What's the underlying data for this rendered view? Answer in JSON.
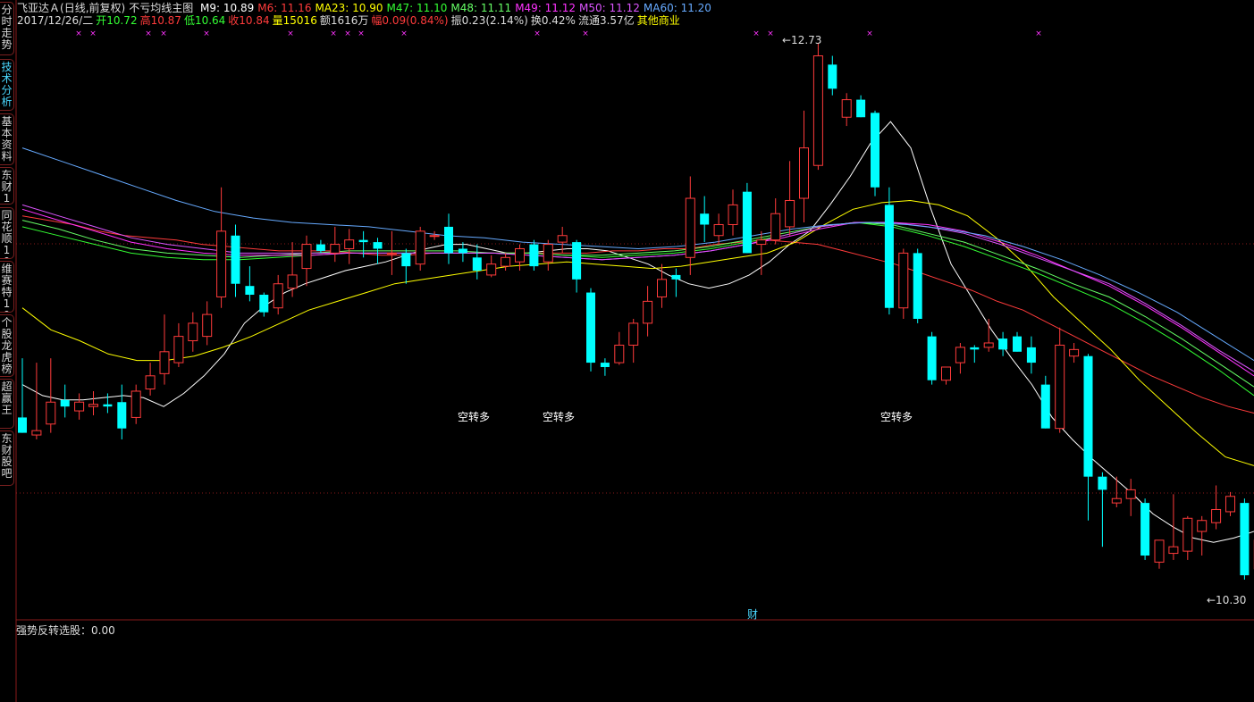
{
  "sidebar": [
    {
      "label": "分时走势",
      "active": false
    },
    {
      "label": "技术分析",
      "active": true
    },
    {
      "label": "基本资料",
      "active": false
    },
    {
      "label": "东财10",
      "active": false
    },
    {
      "label": "同花顺10",
      "active": false
    },
    {
      "label": "维赛特10",
      "active": false
    },
    {
      "label": "个股龙虎榜",
      "active": false
    },
    {
      "label": "超赢王",
      "active": false
    },
    {
      "label": "东财股吧",
      "active": false
    }
  ],
  "header": {
    "name": "飞亚达Ａ",
    "mode": "(日线,前复权)",
    "template": "不亏均线主图",
    "ma": [
      {
        "label": "M9: 10.89",
        "color": "#ffffff"
      },
      {
        "label": "M6: 11.16",
        "color": "#ff3b3b"
      },
      {
        "label": "MA23: 10.90",
        "color": "#ffff00"
      },
      {
        "label": "M47: 11.10",
        "color": "#33ff33"
      },
      {
        "label": "M48: 11.11",
        "color": "#66ff66"
      },
      {
        "label": "M49: 11.12",
        "color": "#ff33ff"
      },
      {
        "label": "M50: 11.12",
        "color": "#dd55ff"
      },
      {
        "label": "MA60: 11.20",
        "color": "#66aaff"
      }
    ],
    "info": [
      {
        "text": "2017/12/26/二",
        "color": "#dddddd"
      },
      {
        "text": "开10.72",
        "color": "#33ff33"
      },
      {
        "text": "高10.87",
        "color": "#ff3b3b"
      },
      {
        "text": "低10.64",
        "color": "#33ff33"
      },
      {
        "text": "收10.84",
        "color": "#ff3b3b"
      },
      {
        "text": "量15016",
        "color": "#ffff00"
      },
      {
        "text": "额1616万",
        "color": "#dddddd"
      },
      {
        "text": "幅0.09(0.84%)",
        "color": "#ff3b3b"
      },
      {
        "text": "振0.23(2.14%)",
        "color": "#dddddd"
      },
      {
        "text": "换0.42%",
        "color": "#dddddd"
      },
      {
        "text": "流通3.57亿",
        "color": "#dddddd"
      },
      {
        "text": "其他商业",
        "color": "#ffff00"
      }
    ]
  },
  "chart_data": {
    "type": "candlestick",
    "ylim": [
      10.2,
      12.8
    ],
    "max_label": "12.73",
    "min_label": "10.30",
    "annotations": [
      "空转多",
      "空转多",
      "空转多"
    ],
    "bottom_marker": "财",
    "candles": [
      {
        "o": 11.05,
        "h": 11.32,
        "l": 11.4,
        "c": 10.98
      },
      {
        "o": 10.97,
        "h": 11.3,
        "l": 10.95,
        "c": 10.99
      },
      {
        "o": 11.02,
        "h": 11.32,
        "l": 10.98,
        "c": 11.12
      },
      {
        "o": 11.13,
        "h": 11.2,
        "l": 11.05,
        "c": 11.1
      },
      {
        "o": 11.08,
        "h": 11.16,
        "l": 11.04,
        "c": 11.12
      },
      {
        "o": 11.1,
        "h": 11.17,
        "l": 11.06,
        "c": 11.11
      },
      {
        "o": 11.11,
        "h": 11.16,
        "l": 11.07,
        "c": 11.1
      },
      {
        "o": 11.12,
        "h": 11.2,
        "l": 10.95,
        "c": 11.0
      },
      {
        "o": 11.05,
        "h": 11.2,
        "l": 11.02,
        "c": 11.17
      },
      {
        "o": 11.18,
        "h": 11.3,
        "l": 11.15,
        "c": 11.24
      },
      {
        "o": 11.25,
        "h": 11.52,
        "l": 11.2,
        "c": 11.35
      },
      {
        "o": 11.3,
        "h": 11.48,
        "l": 11.28,
        "c": 11.42
      },
      {
        "o": 11.4,
        "h": 11.53,
        "l": 11.35,
        "c": 11.48
      },
      {
        "o": 11.42,
        "h": 11.58,
        "l": 11.38,
        "c": 11.52
      },
      {
        "o": 11.6,
        "h": 12.1,
        "l": 11.55,
        "c": 11.9
      },
      {
        "o": 11.88,
        "h": 11.93,
        "l": 11.6,
        "c": 11.66
      },
      {
        "o": 11.65,
        "h": 11.74,
        "l": 11.58,
        "c": 11.61
      },
      {
        "o": 11.61,
        "h": 11.62,
        "l": 11.51,
        "c": 11.53
      },
      {
        "o": 11.55,
        "h": 11.7,
        "l": 11.52,
        "c": 11.66
      },
      {
        "o": 11.64,
        "h": 11.85,
        "l": 11.6,
        "c": 11.7
      },
      {
        "o": 11.73,
        "h": 11.88,
        "l": 11.65,
        "c": 11.84
      },
      {
        "o": 11.84,
        "h": 11.86,
        "l": 11.8,
        "c": 11.81
      },
      {
        "o": 11.8,
        "h": 11.92,
        "l": 11.76,
        "c": 11.84
      },
      {
        "o": 11.82,
        "h": 11.91,
        "l": 11.75,
        "c": 11.86
      },
      {
        "o": 11.86,
        "h": 11.9,
        "l": 11.78,
        "c": 11.85
      },
      {
        "o": 11.85,
        "h": 11.87,
        "l": 11.75,
        "c": 11.82
      },
      {
        "o": 11.8,
        "h": 11.9,
        "l": 11.7,
        "c": 11.8
      },
      {
        "o": 11.8,
        "h": 11.82,
        "l": 11.66,
        "c": 11.74
      },
      {
        "o": 11.75,
        "h": 11.92,
        "l": 11.72,
        "c": 11.9
      },
      {
        "o": 11.88,
        "h": 11.9,
        "l": 11.86,
        "c": 11.88
      },
      {
        "o": 11.92,
        "h": 11.98,
        "l": 11.75,
        "c": 11.8
      },
      {
        "o": 11.82,
        "h": 11.85,
        "l": 11.76,
        "c": 11.8
      },
      {
        "o": 11.78,
        "h": 11.84,
        "l": 11.68,
        "c": 11.72
      },
      {
        "o": 11.7,
        "h": 11.79,
        "l": 11.69,
        "c": 11.75
      },
      {
        "o": 11.74,
        "h": 11.8,
        "l": 11.72,
        "c": 11.78
      },
      {
        "o": 11.76,
        "h": 11.84,
        "l": 11.72,
        "c": 11.82
      },
      {
        "o": 11.84,
        "h": 11.86,
        "l": 11.72,
        "c": 11.74
      },
      {
        "o": 11.76,
        "h": 11.86,
        "l": 11.72,
        "c": 11.84
      },
      {
        "o": 11.85,
        "h": 11.92,
        "l": 11.8,
        "c": 11.88
      },
      {
        "o": 11.85,
        "h": 11.86,
        "l": 11.62,
        "c": 11.68
      },
      {
        "o": 11.62,
        "h": 11.64,
        "l": 11.26,
        "c": 11.3
      },
      {
        "o": 11.3,
        "h": 11.32,
        "l": 11.24,
        "c": 11.28
      },
      {
        "o": 11.3,
        "h": 11.44,
        "l": 11.29,
        "c": 11.38
      },
      {
        "o": 11.38,
        "h": 11.5,
        "l": 11.3,
        "c": 11.48
      },
      {
        "o": 11.48,
        "h": 11.65,
        "l": 11.42,
        "c": 11.58
      },
      {
        "o": 11.6,
        "h": 11.75,
        "l": 11.55,
        "c": 11.68
      },
      {
        "o": 11.7,
        "h": 11.73,
        "l": 11.6,
        "c": 11.68
      },
      {
        "o": 11.78,
        "h": 12.15,
        "l": 11.7,
        "c": 12.05
      },
      {
        "o": 11.98,
        "h": 12.06,
        "l": 11.85,
        "c": 11.93
      },
      {
        "o": 11.88,
        "h": 11.98,
        "l": 11.84,
        "c": 11.93
      },
      {
        "o": 11.93,
        "h": 12.09,
        "l": 11.88,
        "c": 12.02
      },
      {
        "o": 12.08,
        "h": 12.12,
        "l": 11.8,
        "c": 11.8
      },
      {
        "o": 11.84,
        "h": 11.9,
        "l": 11.7,
        "c": 11.86
      },
      {
        "o": 11.86,
        "h": 12.05,
        "l": 11.84,
        "c": 11.98
      },
      {
        "o": 11.92,
        "h": 12.22,
        "l": 11.88,
        "c": 12.04
      },
      {
        "o": 12.05,
        "h": 12.45,
        "l": 11.94,
        "c": 12.28
      },
      {
        "o": 12.2,
        "h": 12.76,
        "l": 12.18,
        "c": 12.7
      },
      {
        "o": 12.66,
        "h": 12.7,
        "l": 12.52,
        "c": 12.55
      },
      {
        "o": 12.42,
        "h": 12.53,
        "l": 12.38,
        "c": 12.5
      },
      {
        "o": 12.5,
        "h": 12.52,
        "l": 12.42,
        "c": 12.42
      },
      {
        "o": 12.44,
        "h": 12.45,
        "l": 12.06,
        "c": 12.1
      },
      {
        "o": 12.02,
        "h": 12.1,
        "l": 11.52,
        "c": 11.55
      },
      {
        "o": 11.55,
        "h": 11.82,
        "l": 11.5,
        "c": 11.8
      },
      {
        "o": 11.8,
        "h": 11.82,
        "l": 11.48,
        "c": 11.5
      },
      {
        "o": 11.42,
        "h": 11.44,
        "l": 11.2,
        "c": 11.22
      },
      {
        "o": 11.22,
        "h": 11.28,
        "l": 11.2,
        "c": 11.28
      },
      {
        "o": 11.3,
        "h": 11.39,
        "l": 11.25,
        "c": 11.37
      },
      {
        "o": 11.37,
        "h": 11.38,
        "l": 11.3,
        "c": 11.36
      },
      {
        "o": 11.37,
        "h": 11.5,
        "l": 11.35,
        "c": 11.39
      },
      {
        "o": 11.41,
        "h": 11.44,
        "l": 11.33,
        "c": 11.36
      },
      {
        "o": 11.42,
        "h": 11.44,
        "l": 11.36,
        "c": 11.35
      },
      {
        "o": 11.37,
        "h": 11.42,
        "l": 11.25,
        "c": 11.3
      },
      {
        "o": 11.2,
        "h": 11.24,
        "l": 11.01,
        "c": 11.0
      },
      {
        "o": 11.0,
        "h": 11.46,
        "l": 10.98,
        "c": 11.38
      },
      {
        "o": 11.33,
        "h": 11.39,
        "l": 11.3,
        "c": 11.36
      },
      {
        "o": 11.33,
        "h": 11.34,
        "l": 10.58,
        "c": 10.78
      },
      {
        "o": 10.78,
        "h": 10.8,
        "l": 10.46,
        "c": 10.72
      },
      {
        "o": 10.66,
        "h": 10.78,
        "l": 10.64,
        "c": 10.68
      },
      {
        "o": 10.68,
        "h": 10.77,
        "l": 10.6,
        "c": 10.72
      },
      {
        "o": 10.66,
        "h": 10.68,
        "l": 10.4,
        "c": 10.42
      },
      {
        "o": 10.39,
        "h": 10.47,
        "l": 10.36,
        "c": 10.49
      },
      {
        "o": 10.43,
        "h": 10.7,
        "l": 10.4,
        "c": 10.46
      },
      {
        "o": 10.44,
        "h": 10.6,
        "l": 10.4,
        "c": 10.59
      },
      {
        "o": 10.53,
        "h": 10.6,
        "l": 10.42,
        "c": 10.58
      },
      {
        "o": 10.57,
        "h": 10.74,
        "l": 10.54,
        "c": 10.63
      },
      {
        "o": 10.62,
        "h": 10.71,
        "l": 10.6,
        "c": 10.69
      },
      {
        "o": 10.66,
        "h": 10.68,
        "l": 10.31,
        "c": 10.33
      },
      {
        "o": 10.36,
        "h": 10.51,
        "l": 10.3,
        "c": 10.49
      },
      {
        "o": 10.49,
        "h": 10.54,
        "l": 10.47,
        "c": 10.49
      },
      {
        "o": 10.48,
        "h": 10.74,
        "l": 10.48,
        "c": 10.69
      }
    ],
    "series": [
      {
        "name": "M9",
        "color": "#ffffff",
        "values": [
          11.2,
          11.15,
          11.13,
          11.13,
          11.14,
          11.15,
          11.14,
          11.1,
          11.16,
          11.24,
          11.34,
          11.48,
          11.56,
          11.62,
          11.66,
          11.69,
          11.72,
          11.74,
          11.76,
          11.79,
          11.82,
          11.84,
          11.84,
          11.82,
          11.8,
          11.8,
          11.81,
          11.82,
          11.82,
          11.81,
          11.78,
          11.75,
          11.7,
          11.66,
          11.64,
          11.66,
          11.7,
          11.76,
          11.84,
          11.9,
          12.02,
          12.15,
          12.3,
          12.4,
          12.28,
          12.0,
          11.75,
          11.6,
          11.45,
          11.32,
          11.2,
          11.05,
          10.95,
          10.86,
          10.78,
          10.7,
          10.61,
          10.55,
          10.5,
          10.48,
          10.5,
          10.53
        ]
      },
      {
        "name": "M6",
        "color": "#ff3b3b",
        "values": [
          11.97,
          11.95,
          11.93,
          11.9,
          11.88,
          11.87,
          11.86,
          11.84,
          11.83,
          11.82,
          11.81,
          11.81,
          11.81,
          11.8,
          11.79,
          11.79,
          11.8,
          11.8,
          11.8,
          11.8,
          11.8,
          11.8,
          11.8,
          11.81,
          11.81,
          11.82,
          11.82,
          11.84,
          11.85,
          11.86,
          11.85,
          11.84,
          11.81,
          11.78,
          11.75,
          11.71,
          11.67,
          11.63,
          11.58,
          11.54,
          11.48,
          11.42,
          11.36,
          11.3,
          11.24,
          11.19,
          11.14,
          11.1,
          11.07
        ]
      },
      {
        "name": "MA23",
        "color": "#ffff00",
        "values": [
          11.55,
          11.45,
          11.4,
          11.34,
          11.31,
          11.31,
          11.33,
          11.37,
          11.42,
          11.48,
          11.54,
          11.58,
          11.62,
          11.66,
          11.68,
          11.7,
          11.72,
          11.74,
          11.75,
          11.76,
          11.75,
          11.74,
          11.73,
          11.74,
          11.76,
          11.78,
          11.8,
          11.85,
          11.93,
          12.0,
          12.03,
          12.04,
          12.02,
          11.97,
          11.87,
          11.75,
          11.6,
          11.48,
          11.36,
          11.22,
          11.1,
          10.98,
          10.87,
          10.83
        ]
      },
      {
        "name": "M47",
        "color": "#33ff33",
        "values": [
          11.92,
          11.88,
          11.84,
          11.8,
          11.78,
          11.77,
          11.77,
          11.78,
          11.79,
          11.8,
          11.8,
          11.8,
          11.8,
          11.8,
          11.8,
          11.79,
          11.78,
          11.79,
          11.8,
          11.82,
          11.85,
          11.88,
          11.92,
          11.94,
          11.92,
          11.88,
          11.83,
          11.77,
          11.71,
          11.64,
          11.57,
          11.48,
          11.38,
          11.27,
          11.15
        ]
      },
      {
        "name": "M48",
        "color": "#66ff66",
        "values": [
          11.95,
          11.91,
          11.86,
          11.82,
          11.8,
          11.79,
          11.78,
          11.79,
          11.8,
          11.81,
          11.81,
          11.81,
          11.81,
          11.8,
          11.8,
          11.79,
          11.79,
          11.8,
          11.81,
          11.83,
          11.86,
          11.89,
          11.92,
          11.94,
          11.93,
          11.89,
          11.85,
          11.79,
          11.73,
          11.66,
          11.6,
          11.51,
          11.41,
          11.3,
          11.19
        ]
      },
      {
        "name": "M49",
        "color": "#ff33ff",
        "values": [
          12.0,
          11.95,
          11.9,
          11.85,
          11.82,
          11.8,
          11.79,
          11.79,
          11.79,
          11.8,
          11.8,
          11.8,
          11.8,
          11.8,
          11.79,
          11.78,
          11.77,
          11.78,
          11.79,
          11.81,
          11.84,
          11.87,
          11.91,
          11.94,
          11.94,
          11.93,
          11.9,
          11.85,
          11.79,
          11.72,
          11.65,
          11.56,
          11.46,
          11.35,
          11.24
        ]
      },
      {
        "name": "M50",
        "color": "#dd55ff",
        "values": [
          12.02,
          11.97,
          11.92,
          11.87,
          11.84,
          11.82,
          11.8,
          11.8,
          11.8,
          11.8,
          11.8,
          11.8,
          11.8,
          11.8,
          11.79,
          11.78,
          11.77,
          11.78,
          11.79,
          11.81,
          11.84,
          11.88,
          11.92,
          11.94,
          11.94,
          11.92,
          11.89,
          11.84,
          11.78,
          11.72,
          11.66,
          11.57,
          11.47,
          11.36,
          11.26
        ]
      },
      {
        "name": "MA60",
        "color": "#66aaff",
        "values": [
          12.28,
          12.22,
          12.16,
          12.1,
          12.04,
          11.99,
          11.96,
          11.94,
          11.93,
          11.92,
          11.9,
          11.88,
          11.87,
          11.85,
          11.84,
          11.83,
          11.82,
          11.83,
          11.85,
          11.88,
          11.91,
          11.93,
          11.94,
          11.93,
          11.91,
          11.88,
          11.83,
          11.77,
          11.7,
          11.62,
          11.53,
          11.42,
          11.31
        ]
      }
    ]
  },
  "indicator": {
    "label": "强势反转选股：0.00"
  }
}
